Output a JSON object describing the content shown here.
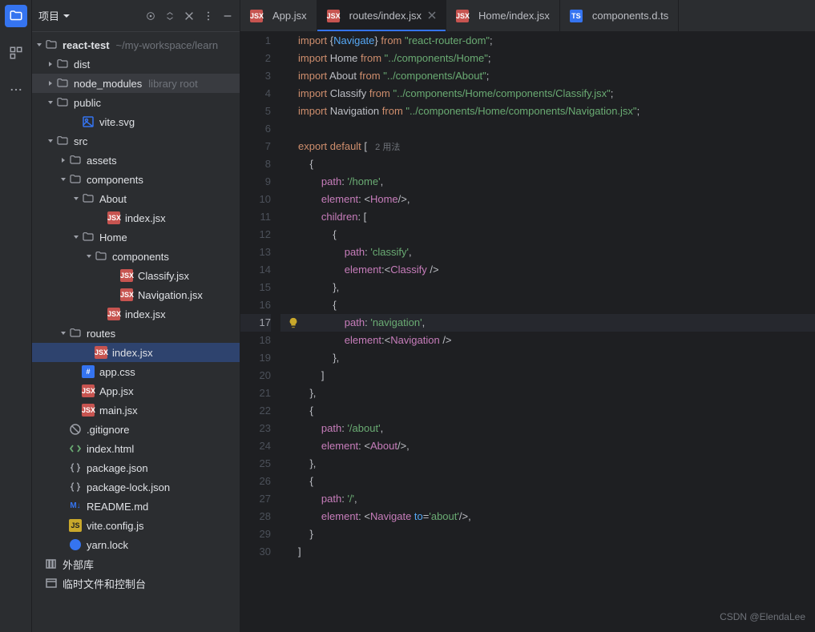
{
  "sidebar": {
    "title": "项目"
  },
  "project": {
    "root": {
      "name": "react-test",
      "hint": "~/my-workspace/learn"
    },
    "nodes": [
      {
        "pad": 14,
        "chev": "right",
        "icon": "folder",
        "label": "dist"
      },
      {
        "pad": 14,
        "chev": "right",
        "icon": "folder",
        "label": "node_modules",
        "hint": "library root",
        "hl": true
      },
      {
        "pad": 14,
        "chev": "down",
        "icon": "folder",
        "label": "public"
      },
      {
        "pad": 46,
        "icon": "svg",
        "label": "vite.svg"
      },
      {
        "pad": 14,
        "chev": "down",
        "icon": "folder",
        "label": "src"
      },
      {
        "pad": 30,
        "chev": "right",
        "icon": "folder",
        "label": "assets"
      },
      {
        "pad": 30,
        "chev": "down",
        "icon": "folder",
        "label": "components"
      },
      {
        "pad": 46,
        "chev": "down",
        "icon": "folder",
        "label": "About"
      },
      {
        "pad": 78,
        "icon": "jsx",
        "label": "index.jsx"
      },
      {
        "pad": 46,
        "chev": "down",
        "icon": "folder",
        "label": "Home"
      },
      {
        "pad": 62,
        "chev": "down",
        "icon": "folder",
        "label": "components"
      },
      {
        "pad": 94,
        "icon": "jsx",
        "label": "Classify.jsx"
      },
      {
        "pad": 94,
        "icon": "jsx",
        "label": "Navigation.jsx"
      },
      {
        "pad": 78,
        "icon": "jsx",
        "label": "index.jsx"
      },
      {
        "pad": 30,
        "chev": "down",
        "icon": "folder",
        "label": "routes"
      },
      {
        "pad": 62,
        "icon": "jsx",
        "label": "index.jsx",
        "sel": true
      },
      {
        "pad": 46,
        "icon": "css",
        "label": "app.css"
      },
      {
        "pad": 46,
        "icon": "jsx",
        "label": "App.jsx"
      },
      {
        "pad": 46,
        "icon": "jsx",
        "label": "main.jsx"
      },
      {
        "pad": 30,
        "icon": "gitignore",
        "label": ".gitignore"
      },
      {
        "pad": 30,
        "icon": "html",
        "label": "index.html"
      },
      {
        "pad": 30,
        "icon": "json",
        "label": "package.json"
      },
      {
        "pad": 30,
        "icon": "json",
        "label": "package-lock.json"
      },
      {
        "pad": 30,
        "icon": "md",
        "label": "README.md"
      },
      {
        "pad": 30,
        "icon": "js",
        "label": "vite.config.js"
      },
      {
        "pad": 30,
        "icon": "yarn",
        "label": "yarn.lock"
      }
    ],
    "footer": [
      {
        "icon": "lib",
        "label": "外部库"
      },
      {
        "icon": "scratch",
        "label": "临时文件和控制台"
      }
    ]
  },
  "tabs": [
    {
      "icon": "jsx",
      "label": "App.jsx"
    },
    {
      "icon": "jsx",
      "label": "routes/index.jsx",
      "active": true
    },
    {
      "icon": "jsx",
      "label": "Home/index.jsx"
    },
    {
      "icon": "ts",
      "label": "components.d.ts"
    }
  ],
  "code": {
    "highlight_line": 17,
    "inlay_usages": "2 用法",
    "lines": [
      [
        [
          "kw",
          "import"
        ],
        [
          "punct",
          " {"
        ],
        [
          "fn",
          "Navigate"
        ],
        [
          "punct",
          "} "
        ],
        [
          "kw",
          "from"
        ],
        [
          "punct",
          " "
        ],
        [
          "str",
          "\"react-router-dom\""
        ],
        [
          "punct",
          ";"
        ]
      ],
      [
        [
          "kw",
          "import"
        ],
        [
          "punct",
          " Home "
        ],
        [
          "kw",
          "from"
        ],
        [
          "punct",
          " "
        ],
        [
          "str",
          "\"../components/Home\""
        ],
        [
          "punct",
          ";"
        ]
      ],
      [
        [
          "kw",
          "import"
        ],
        [
          "punct",
          " About "
        ],
        [
          "kw",
          "from"
        ],
        [
          "punct",
          " "
        ],
        [
          "str",
          "\"../components/About\""
        ],
        [
          "punct",
          ";"
        ]
      ],
      [
        [
          "kw",
          "import"
        ],
        [
          "punct",
          " Classify "
        ],
        [
          "kw",
          "from"
        ],
        [
          "punct",
          " "
        ],
        [
          "str",
          "\"../components/Home/components/Classify.jsx\""
        ],
        [
          "punct",
          ";"
        ]
      ],
      [
        [
          "kw",
          "import"
        ],
        [
          "punct",
          " Navigation "
        ],
        [
          "kw",
          "from"
        ],
        [
          "punct",
          " "
        ],
        [
          "str",
          "\"../components/Home/components/Navigation.jsx\""
        ],
        [
          "punct",
          ";"
        ]
      ],
      [],
      [
        [
          "kw",
          "export"
        ],
        [
          "punct",
          " "
        ],
        [
          "kw",
          "default"
        ],
        [
          "punct",
          " ["
        ],
        [
          "inlay",
          "  2 用法"
        ]
      ],
      [
        [
          "punct",
          "    {"
        ]
      ],
      [
        [
          "punct",
          "        "
        ],
        [
          "prop",
          "path"
        ],
        [
          "punct",
          ": "
        ],
        [
          "str",
          "'/home'"
        ],
        [
          "punct",
          ","
        ]
      ],
      [
        [
          "punct",
          "        "
        ],
        [
          "prop",
          "element"
        ],
        [
          "punct",
          ": <"
        ],
        [
          "comp",
          "Home"
        ],
        [
          "punct",
          "/>,"
        ]
      ],
      [
        [
          "punct",
          "        "
        ],
        [
          "prop",
          "children"
        ],
        [
          "punct",
          ": ["
        ]
      ],
      [
        [
          "punct",
          "            {"
        ]
      ],
      [
        [
          "punct",
          "                "
        ],
        [
          "prop",
          "path"
        ],
        [
          "punct",
          ": "
        ],
        [
          "str",
          "'classify'"
        ],
        [
          "punct",
          ","
        ]
      ],
      [
        [
          "punct",
          "                "
        ],
        [
          "prop",
          "element"
        ],
        [
          "punct",
          ":<"
        ],
        [
          "comp",
          "Classify"
        ],
        [
          "punct",
          " />"
        ]
      ],
      [
        [
          "punct",
          "            },"
        ]
      ],
      [
        [
          "punct",
          "            {"
        ]
      ],
      [
        [
          "punct",
          "                "
        ],
        [
          "prop",
          "path"
        ],
        [
          "punct",
          ": "
        ],
        [
          "str",
          "'navigation'"
        ],
        [
          "punct",
          ","
        ]
      ],
      [
        [
          "punct",
          "                "
        ],
        [
          "prop",
          "element"
        ],
        [
          "punct",
          ":<"
        ],
        [
          "comp",
          "Navigation"
        ],
        [
          "punct",
          " />"
        ]
      ],
      [
        [
          "punct",
          "            },"
        ]
      ],
      [
        [
          "punct",
          "        ]"
        ]
      ],
      [
        [
          "punct",
          "    },"
        ]
      ],
      [
        [
          "punct",
          "    {"
        ]
      ],
      [
        [
          "punct",
          "        "
        ],
        [
          "prop",
          "path"
        ],
        [
          "punct",
          ": "
        ],
        [
          "str",
          "'/about'"
        ],
        [
          "punct",
          ","
        ]
      ],
      [
        [
          "punct",
          "        "
        ],
        [
          "prop",
          "element"
        ],
        [
          "punct",
          ": <"
        ],
        [
          "comp",
          "About"
        ],
        [
          "punct",
          "/>,"
        ]
      ],
      [
        [
          "punct",
          "    },"
        ]
      ],
      [
        [
          "punct",
          "    {"
        ]
      ],
      [
        [
          "punct",
          "        "
        ],
        [
          "prop",
          "path"
        ],
        [
          "punct",
          ": "
        ],
        [
          "str",
          "'/'"
        ],
        [
          "punct",
          ","
        ]
      ],
      [
        [
          "punct",
          "        "
        ],
        [
          "prop",
          "element"
        ],
        [
          "punct",
          ": <"
        ],
        [
          "comp",
          "Navigate"
        ],
        [
          "punct",
          " "
        ],
        [
          "fn",
          "to"
        ],
        [
          "punct",
          "="
        ],
        [
          "str",
          "'about'"
        ],
        [
          "punct",
          "/>,"
        ]
      ],
      [
        [
          "punct",
          "    }"
        ]
      ],
      [
        [
          "punct",
          "]"
        ]
      ]
    ]
  },
  "watermark": "CSDN @ElendaLee"
}
